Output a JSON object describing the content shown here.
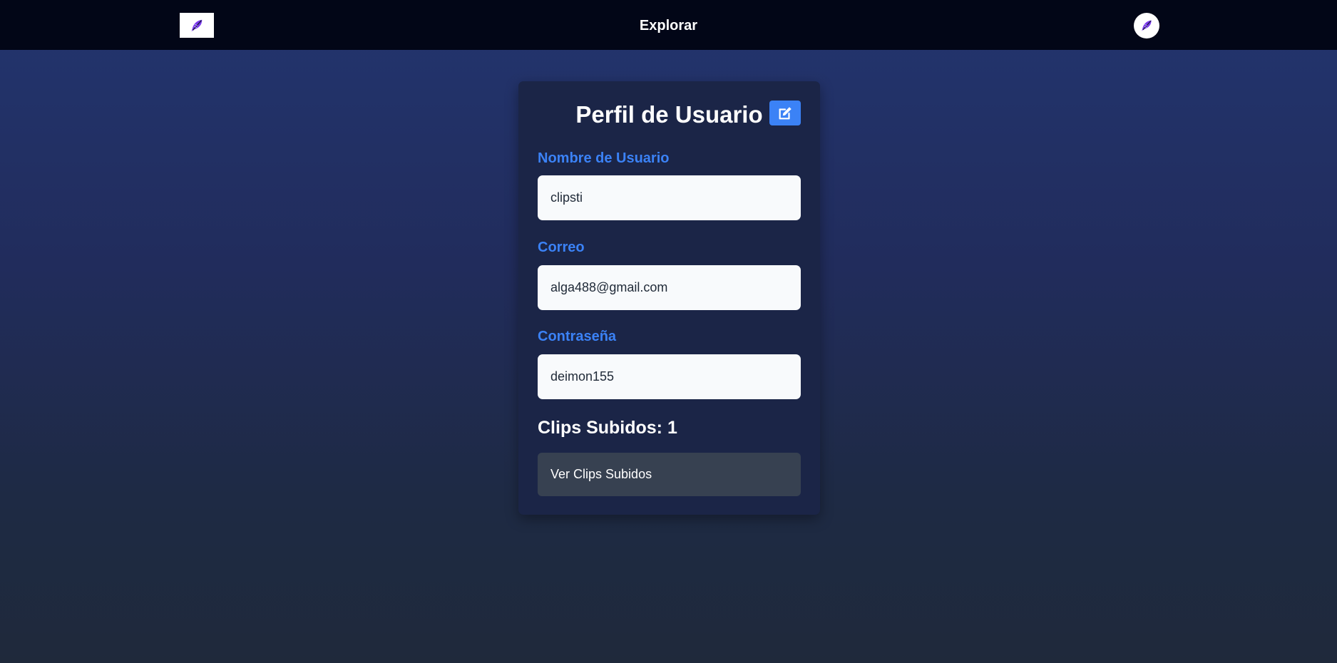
{
  "header": {
    "nav_label": "Explorar",
    "logo_icon": "feather-pen-icon",
    "avatar_icon": "feather-pen-icon"
  },
  "profile": {
    "title": "Perfil de Usuario",
    "edit_icon": "edit-icon",
    "fields": [
      {
        "label": "Nombre de Usuario",
        "value": "clipsti"
      },
      {
        "label": "Correo",
        "value": "alga488@gmail.com"
      },
      {
        "label": "Contraseña",
        "value": "deimon155"
      }
    ],
    "clips_heading": "Clips Subidos: 1",
    "clips_button_label": "Ver Clips Subidos"
  },
  "colors": {
    "accent": "#3b82f6",
    "topbar": "#020617",
    "card": "#1b2547",
    "button_secondary": "#374151"
  }
}
